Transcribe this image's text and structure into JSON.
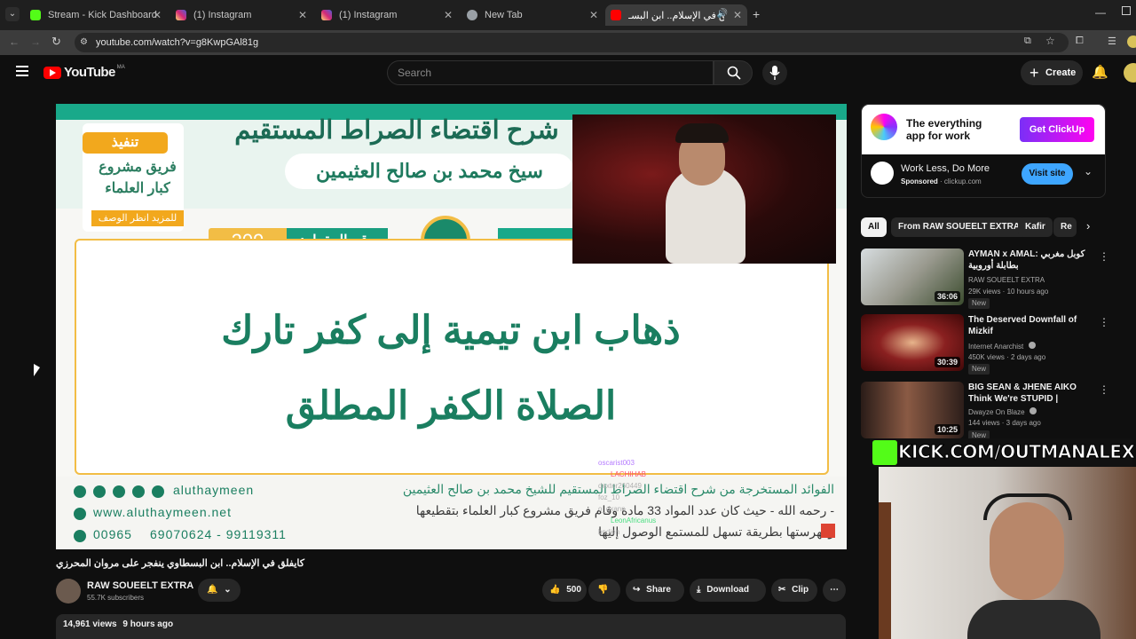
{
  "browser": {
    "tabs": [
      {
        "title": "Stream - Kick Dashboard",
        "favicon": "kick-icon",
        "color": "#53fc18"
      },
      {
        "title": "(1) Instagram",
        "favicon": "instagram-icon",
        "color": "#d62976"
      },
      {
        "title": "(1) Instagram",
        "favicon": "instagram-icon",
        "color": "#d62976"
      },
      {
        "title": "New Tab",
        "favicon": "globe-icon",
        "color": "#9aa0a6"
      },
      {
        "title": "كايفلق في الإسلام.. ابن البسـ",
        "favicon": "youtube-icon",
        "color": "#ff0000",
        "active": true
      }
    ],
    "url": "youtube.com/watch?v=g8KwpGAl81g"
  },
  "youtube": {
    "logo_text": "YouTube",
    "country": "MA",
    "search_placeholder": "Search",
    "create_label": "Create"
  },
  "video": {
    "header_title": "شرح اقتضاء الصراط المستقيم",
    "scholar_name": "سيخ محمد بن صالح العثيمين",
    "badge_top": "تنفيذ",
    "badge_team": "فريق مشروع كبار العلماء",
    "badge_more": "للمزيد انظر الوصف",
    "clip_label": "رقم المقطع:",
    "clip_number": "209",
    "main_line_1": "ذهاب ابن تيمية إلى كفر تارك",
    "main_line_2": "الصلاة الكفر المطلق",
    "social_handle": "aluthaymeen",
    "website": "www.aluthaymeen.net",
    "phone_code": "00965",
    "phone_numbers": "69070624 - 99119311",
    "footer_line_1": "الفوائد المستخرجة من شرح اقتضاء الصراط المستقيم للشيخ محمد بن صالح العثيمين",
    "footer_line_2": "- رحمه الله - حيث كان عدد المواد 33 مادة وقام فريق مشروع كبار العلماء بتقطيعها",
    "footer_line_3": "وفهرستها بطريقة تسهل للمستمع الوصول إليها",
    "chat": [
      {
        "user": "oscarist003",
        "color": "#b57bff"
      },
      {
        "user": "LACHIHAB",
        "color": "#ff4d6d"
      },
      {
        "user": "dexter260449",
        "color": "#b0b0b0"
      },
      {
        "user": "foz_10",
        "color": "#b0b0b0"
      },
      {
        "user": "o_dxann",
        "color": "#b0b0b0"
      },
      {
        "user": "LeonAfricanus",
        "color": "#4ade80"
      },
      {
        "user": "bndjeh",
        "color": "#b0b0b0"
      }
    ],
    "title": "كايفلق في الإسلام.. ابن البسطاوي ينفجر على مروان المحرزي",
    "channel": "RAW SOUEELT EXTRA",
    "subscribers": "55.7K subscribers",
    "likes": "500",
    "share": "Share",
    "download": "Download",
    "clip": "Clip",
    "views": "14,961 views",
    "age": "9 hours ago"
  },
  "ad": {
    "headline": "The everything app for work",
    "cta": "Get ClickUp",
    "title": "Work Less, Do More",
    "sponsored": "Sponsored",
    "domain": "clickup.com",
    "visit": "Visit site"
  },
  "chips": [
    "All",
    "From RAW SOUEELT EXTRA",
    "Kafir",
    "Re"
  ],
  "recommendations": [
    {
      "title": "AYMAN x AMAL: كوبل مغربي بطابلة أوروبية",
      "channel": "RAW SOUEELT EXTRA",
      "meta": "29K views · 10 hours ago",
      "duration": "36:06",
      "badge": "New",
      "verified": false
    },
    {
      "title": "The Deserved Downfall of Mizkif",
      "channel": "Internet Anarchist",
      "meta": "450K views · 2 days ago",
      "duration": "30:39",
      "badge": "New",
      "verified": true
    },
    {
      "title": "BIG SEAN & JHENE AIKO Think We're STUPID | REACTION",
      "channel": "Dwayze On Blaze",
      "meta": "144 views · 3 days ago",
      "duration": "10:25",
      "badge": "New",
      "verified": true
    }
  ],
  "overlay": {
    "kick_url": "KICK.COM/OUTMANALEX"
  }
}
